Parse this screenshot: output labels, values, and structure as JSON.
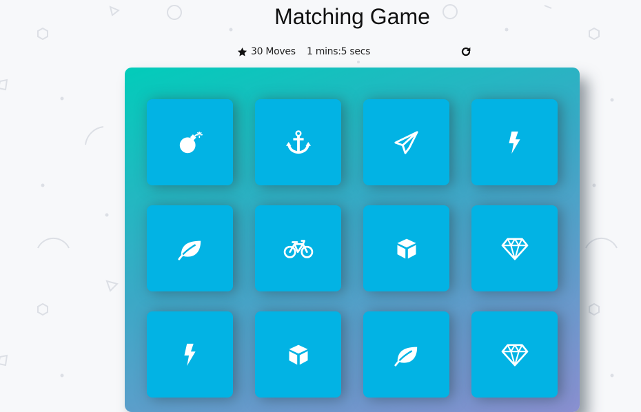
{
  "page": {
    "title": "Matching Game"
  },
  "score_panel": {
    "moves_text": "30 Moves",
    "timer_text": "1 mins:5 secs",
    "star_icon": "star-icon",
    "restart_icon": "repeat-icon"
  },
  "deck": {
    "cards": [
      {
        "icon": "bomb"
      },
      {
        "icon": "anchor"
      },
      {
        "icon": "paper-plane"
      },
      {
        "icon": "bolt"
      },
      {
        "icon": "leaf"
      },
      {
        "icon": "bicycle"
      },
      {
        "icon": "cube"
      },
      {
        "icon": "diamond"
      },
      {
        "icon": "bolt"
      },
      {
        "icon": "cube"
      },
      {
        "icon": "leaf"
      },
      {
        "icon": "diamond"
      }
    ]
  },
  "colors": {
    "background": "#f7f8fa",
    "card": "#02b3e4",
    "deck_gradient_start": "#02ccba",
    "deck_gradient_end": "#8a8fd0",
    "icon": "#ffffff"
  }
}
